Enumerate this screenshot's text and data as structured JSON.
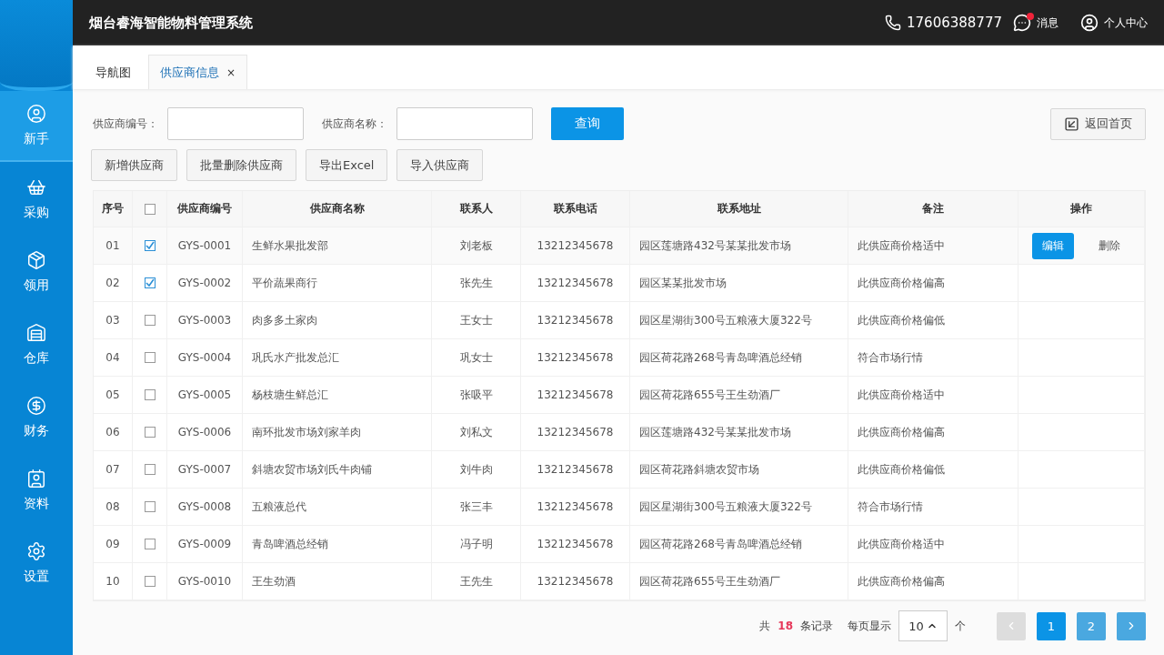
{
  "app": {
    "title": "烟台睿海智能物料管理系统",
    "phone": "17606388777",
    "messages": {
      "label": "消息",
      "unread": true
    },
    "profile": "个人中心"
  },
  "sidebar": {
    "items": [
      {
        "label": "新手",
        "selected": true
      },
      {
        "label": "采购",
        "selected": false
      },
      {
        "label": "领用",
        "selected": false
      },
      {
        "label": "仓库",
        "selected": false
      },
      {
        "label": "财务",
        "selected": false
      },
      {
        "label": "资料",
        "selected": false
      },
      {
        "label": "设置",
        "selected": false
      }
    ]
  },
  "tabs": [
    {
      "label": "导航图",
      "selected": false
    },
    {
      "label": "供应商信息",
      "selected": true,
      "close": "×"
    }
  ],
  "filters": [
    {
      "label": "供应商编号："
    },
    {
      "label": "供应商名称："
    }
  ],
  "query_button": "查询",
  "home_button": "返回首页",
  "actions": [
    "新增供应商",
    "批量删除供应商",
    "导出Excel",
    "导入供应商"
  ],
  "table": {
    "columns": [
      "序号",
      "",
      "供应商编号",
      "供应商名称",
      "联系人",
      "联系电话",
      "联系地址",
      "备注",
      "操作"
    ],
    "select_all_checked": false,
    "rows": [
      {
        "no": "01",
        "checked": true,
        "code": "GYS-0001",
        "name": "生鲜水果批发部",
        "contact": "刘老板",
        "phone": "13212345678",
        "address": "园区莲塘路432号某某批发市场",
        "note": "此供应商价格适中",
        "actions": [
          {
            "label": "编辑",
            "kind": "primary"
          },
          {
            "label": "删除",
            "kind": "plain"
          }
        ]
      },
      {
        "no": "02",
        "checked": true,
        "code": "GYS-0002",
        "name": "平价蔬果商行",
        "contact": "张先生",
        "phone": "13212345678",
        "address": "园区某某批发市场",
        "note": "此供应商价格偏高"
      },
      {
        "no": "03",
        "checked": false,
        "code": "GYS-0003",
        "name": "肉多多土家肉",
        "contact": "王女士",
        "phone": "13212345678",
        "address": "园区星湖街300号五粮液大厦322号",
        "note": "此供应商价格偏低"
      },
      {
        "no": "04",
        "checked": false,
        "code": "GYS-0004",
        "name": "巩氏水产批发总汇",
        "contact": "巩女士",
        "phone": "13212345678",
        "address": "园区荷花路268号青岛啤酒总经销",
        "note": "符合市场行情"
      },
      {
        "no": "05",
        "checked": false,
        "code": "GYS-0005",
        "name": "杨枝塘生鲜总汇",
        "contact": "张吸平",
        "phone": "13212345678",
        "address": "园区荷花路655号王生劲酒厂",
        "note": "此供应商价格适中"
      },
      {
        "no": "06",
        "checked": false,
        "code": "GYS-0006",
        "name": "南环批发市场刘家羊肉",
        "contact": "刘私文",
        "phone": "13212345678",
        "address": "园区莲塘路432号某某批发市场",
        "note": "此供应商价格偏高"
      },
      {
        "no": "07",
        "checked": false,
        "code": "GYS-0007",
        "name": "斜塘农贸市场刘氏牛肉铺",
        "contact": "刘牛肉",
        "phone": "13212345678",
        "address": "园区荷花路斜塘农贸市场",
        "note": "此供应商价格偏低"
      },
      {
        "no": "08",
        "checked": false,
        "code": "GYS-0008",
        "name": "五粮液总代",
        "contact": "张三丰",
        "phone": "13212345678",
        "address": "园区星湖街300号五粮液大厦322号",
        "note": "符合市场行情"
      },
      {
        "no": "09",
        "checked": false,
        "code": "GYS-0009",
        "name": "青岛啤酒总经销",
        "contact": "冯子明",
        "phone": "13212345678",
        "address": "园区荷花路268号青岛啤酒总经销",
        "note": "此供应商价格适中"
      },
      {
        "no": "10",
        "checked": false,
        "code": "GYS-0010",
        "name": "王生劲酒",
        "contact": "王先生",
        "phone": "13212345678",
        "address": "园区荷花路655号王生劲酒厂",
        "note": "此供应商价格偏高"
      }
    ]
  },
  "pagination": {
    "total_prefix": "共",
    "total": "18",
    "total_suffix": "条记录",
    "page_size_label": "每页显示",
    "page_size": "10",
    "page_size_unit": "个",
    "prev_disabled": true,
    "next_disabled": false,
    "pages": [
      {
        "label": "1",
        "selected": true
      },
      {
        "label": "2",
        "selected": false
      }
    ]
  }
}
